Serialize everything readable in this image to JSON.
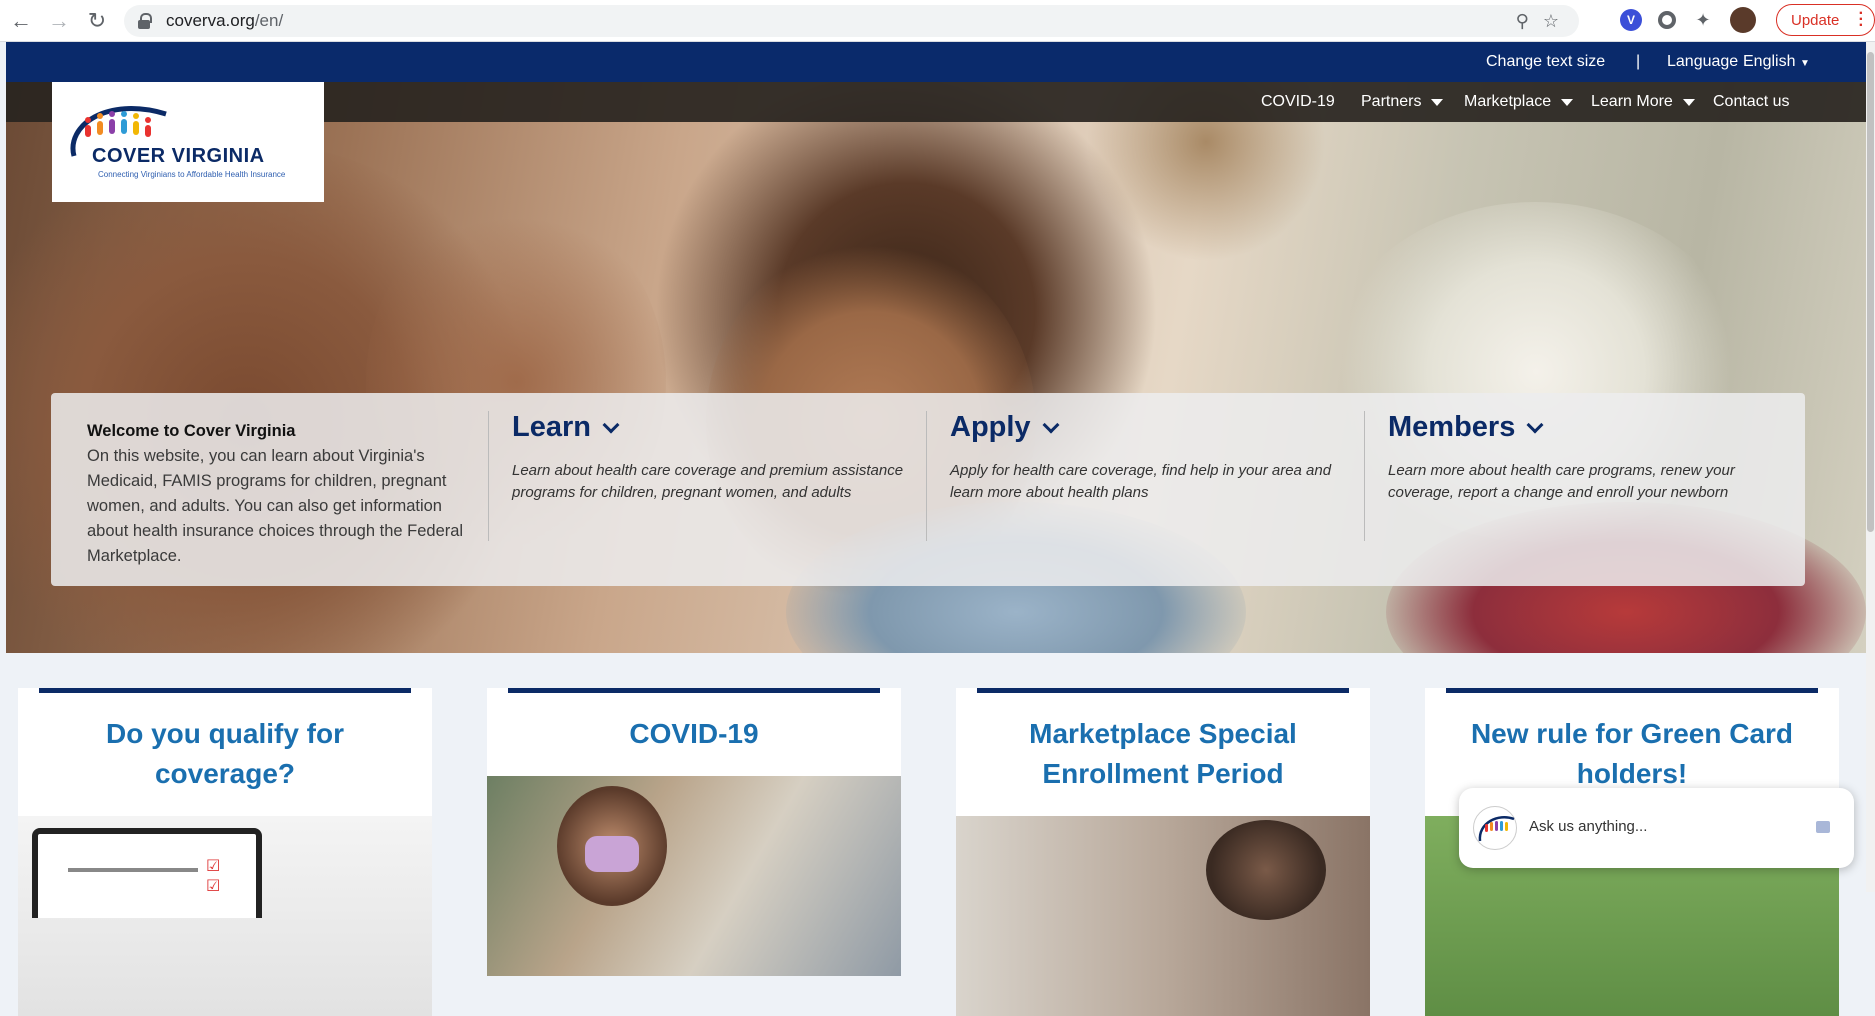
{
  "browser": {
    "url_domain": "coverva.org",
    "url_path": "/en/",
    "update_label": "Update"
  },
  "utility_bar": {
    "text_size": "Change text size",
    "separator": "|",
    "language_label": "Language",
    "language_value": "English"
  },
  "nav": {
    "items": [
      {
        "label": "COVID-19",
        "has_dropdown": false
      },
      {
        "label": "Partners",
        "has_dropdown": true
      },
      {
        "label": "Marketplace",
        "has_dropdown": true
      },
      {
        "label": "Learn More",
        "has_dropdown": true
      },
      {
        "label": "Contact us",
        "has_dropdown": false
      }
    ]
  },
  "logo": {
    "title": "COVER VIRGINIA",
    "tagline": "Connecting Virginians to Affordable Health Insurance"
  },
  "welcome": {
    "heading": "Welcome to Cover Virginia",
    "body": "On this website, you can learn about Virginia's Medicaid, FAMIS programs for children, pregnant women, and adults. You can also get information about health insurance choices through the Federal Marketplace."
  },
  "columns": [
    {
      "title": "Learn",
      "text": "Learn about health care coverage and premium assistance programs for children, pregnant women, and adults"
    },
    {
      "title": "Apply",
      "text": "Apply for health care coverage, find help in your area and learn more about health plans"
    },
    {
      "title": "Members",
      "text": "Learn more about health care programs, renew your coverage, report a change and enroll your newborn"
    }
  ],
  "cards": [
    {
      "title_line1": "Do you qualify for",
      "title_line2": "coverage?"
    },
    {
      "title_line1": "COVID-19",
      "title_line2": ""
    },
    {
      "title_line1": "Marketplace Special",
      "title_line2": "Enrollment Period"
    },
    {
      "title_line1": "New rule for Green Card",
      "title_line2": "holders!"
    }
  ],
  "chat": {
    "placeholder": "Ask us anything..."
  },
  "colors": {
    "navy": "#0a2a6b",
    "card_title": "#1a6faf",
    "update_red": "#d93025"
  }
}
